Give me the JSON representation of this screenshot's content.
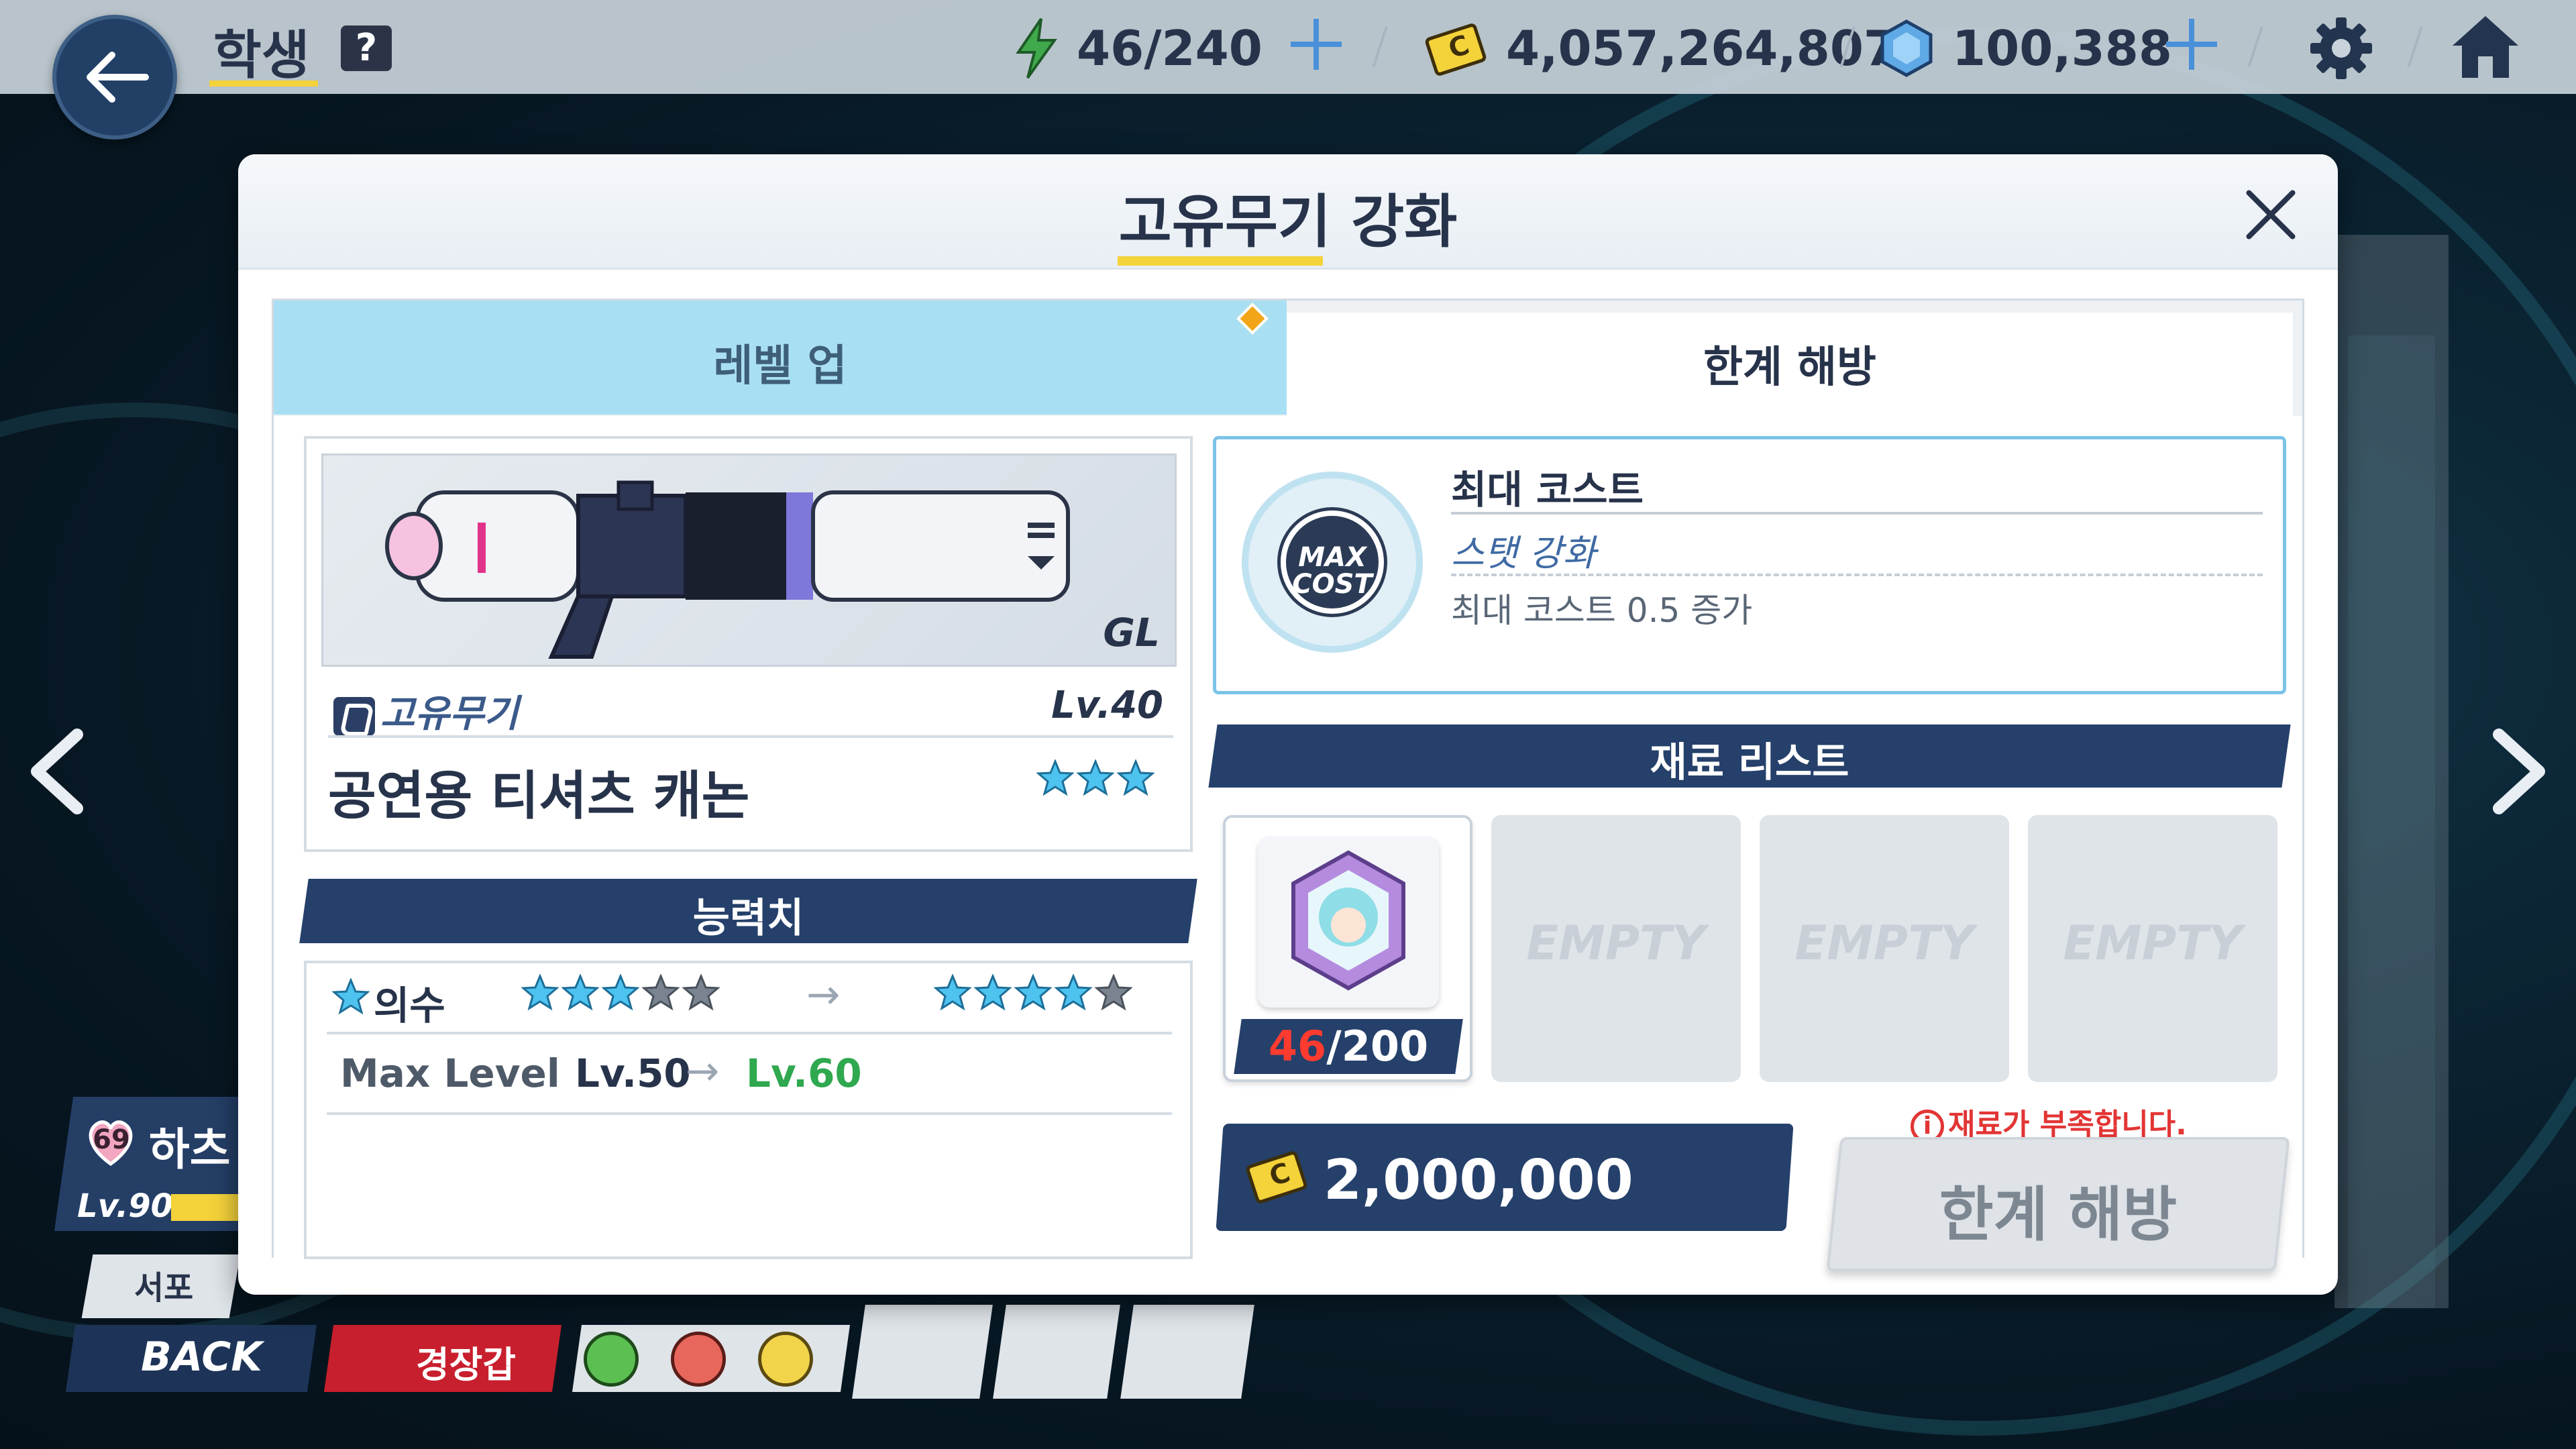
{
  "topbar": {
    "title": "학생",
    "help": "?",
    "ap": "46/240",
    "credits": "4,057,264,807",
    "gems": "100,388"
  },
  "modal": {
    "title": "고유무기 강화",
    "tabs": [
      {
        "label": "레벨 업",
        "active": false
      },
      {
        "label": "한계 해방",
        "active": true
      }
    ]
  },
  "weapon": {
    "type": "GL",
    "category": "고유무기",
    "level": "Lv.40",
    "name": "공연용 티셔츠 캐논",
    "stars": 3
  },
  "stats": {
    "header": "능력치",
    "stars_label": "의수",
    "stars_from": 3,
    "stars_to": 4,
    "stars_max": 5,
    "max_level_label": "Max Level",
    "max_level_from": "Lv.50",
    "max_level_to": "Lv.60"
  },
  "effect": {
    "icon_text_1": "MAX",
    "icon_text_2": "COST",
    "title": "최대 코스트",
    "subtitle": "스탯 강화",
    "description": "최대 코스트 0.5 증가"
  },
  "materials": {
    "header": "재료 리스트",
    "slots": [
      {
        "filled": true,
        "owned": "46",
        "required": "/200"
      },
      {
        "filled": false,
        "label": "EMPTY"
      },
      {
        "filled": false,
        "label": "EMPTY"
      },
      {
        "filled": false,
        "label": "EMPTY"
      }
    ]
  },
  "cost": {
    "amount": "2,000,000"
  },
  "action": {
    "warning": "재료가 부족합니다.",
    "button": "한계 해방",
    "enabled": false
  },
  "bottom": {
    "back_label": "BACK",
    "student_level": "Lv.90",
    "affection": "69",
    "student_name": "하츠",
    "role_btn": "서포",
    "mood_btn": "경장갑"
  },
  "colors": {
    "navy": "#25406a",
    "tab_inactive": "#a9dff3",
    "accent_yellow": "#f4d23a",
    "star_blue": "#4ec3f0",
    "warning_red": "#e23535",
    "level_green": "#2fa84f"
  },
  "icons": [
    "back-arrow-icon",
    "help-icon",
    "ap-bolt-icon",
    "credit-icon",
    "gem-icon",
    "settings-gear-icon",
    "home-icon",
    "close-icon",
    "weapon-category-icon",
    "star-icon",
    "max-cost-icon",
    "material-gem-icon",
    "warning-icon",
    "chevron-left-icon",
    "chevron-right-icon"
  ]
}
